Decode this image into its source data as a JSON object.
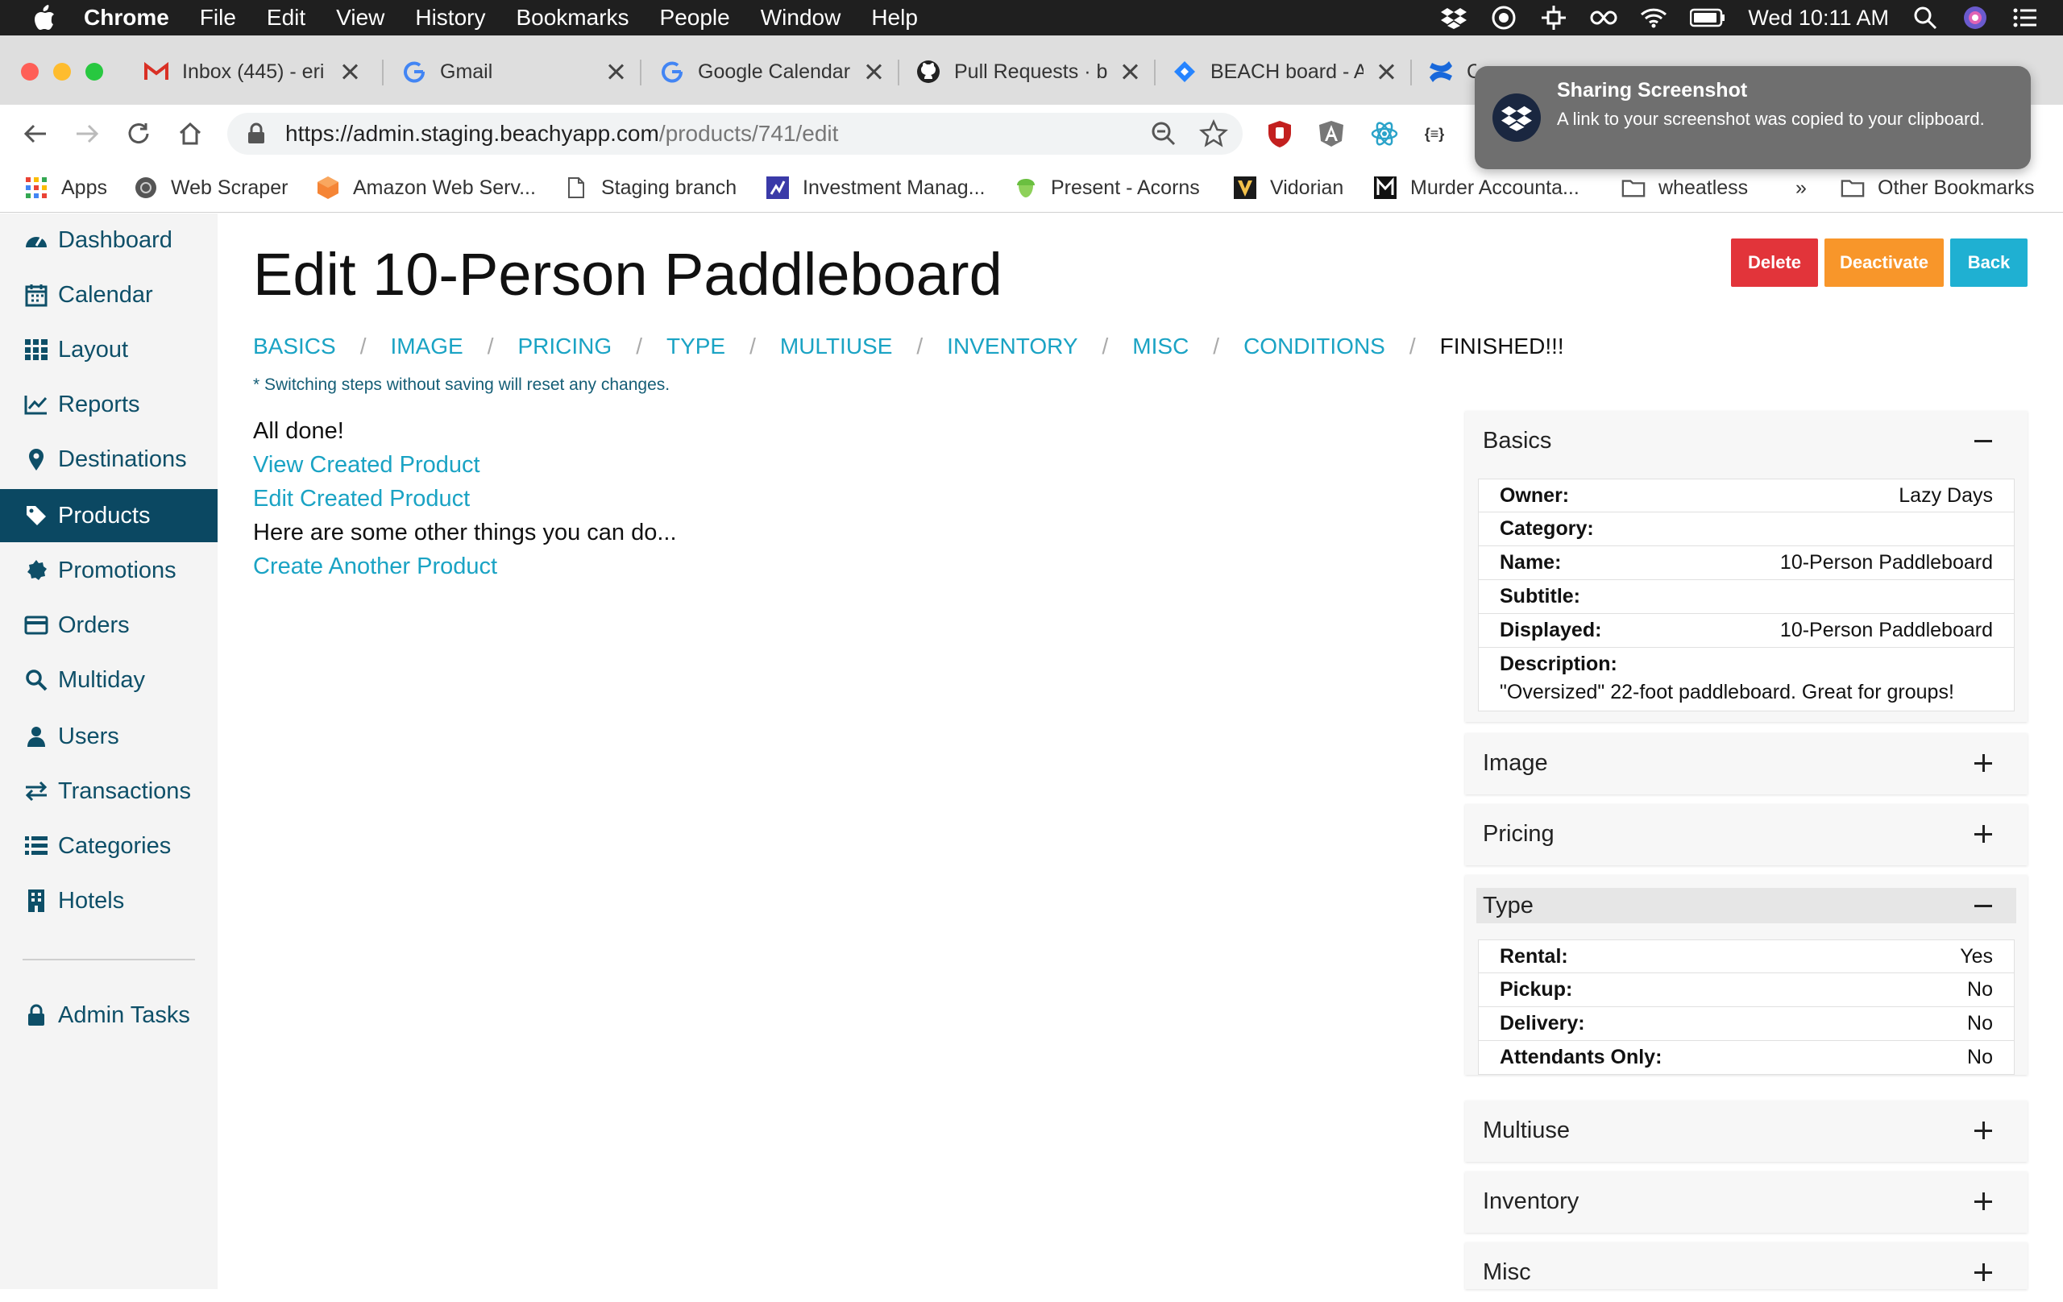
{
  "menubar": {
    "app": "Chrome",
    "items": [
      "File",
      "Edit",
      "View",
      "History",
      "Bookmarks",
      "People",
      "Window",
      "Help"
    ],
    "clock": "Wed 10:11 AM"
  },
  "tabs": [
    {
      "title": "Inbox (445) - eri",
      "icon": "gmail-icon"
    },
    {
      "title": "Gmail",
      "icon": "google-icon"
    },
    {
      "title": "Google Calendar",
      "icon": "google-icon"
    },
    {
      "title": "Pull Requests · b",
      "icon": "github-icon"
    },
    {
      "title": "BEACH board - A",
      "icon": "jira-icon"
    },
    {
      "title": "C",
      "icon": "confluence-icon"
    }
  ],
  "omnibox": {
    "url_host": "https://admin.staging.beachyapp.com",
    "url_path": "/products/741/edit"
  },
  "bookmarks": [
    {
      "label": "Apps",
      "icon": "apps-grid-icon"
    },
    {
      "label": "Web Scraper",
      "icon": "web-scraper-icon"
    },
    {
      "label": "Amazon Web Serv...",
      "icon": "aws-icon"
    },
    {
      "label": "Staging branch",
      "icon": "page-icon"
    },
    {
      "label": "Investment Manag...",
      "icon": "investment-icon"
    },
    {
      "label": "Present - Acorns",
      "icon": "acorns-icon"
    },
    {
      "label": "Vidorian",
      "icon": "vidorian-icon"
    },
    {
      "label": "Murder Accounta...",
      "icon": "murder-icon"
    },
    {
      "label": "wheatless",
      "icon": "folder-icon"
    },
    {
      "label": "»",
      "icon": ""
    },
    {
      "label": "Other Bookmarks",
      "icon": "folder-icon"
    }
  ],
  "notification": {
    "title": "Sharing Screenshot",
    "body": "A link to your screenshot was copied to your clipboard."
  },
  "sidebar": {
    "items": [
      {
        "label": "Dashboard",
        "icon": "dashboard-icon"
      },
      {
        "label": "Calendar",
        "icon": "calendar-icon"
      },
      {
        "label": "Layout",
        "icon": "layout-grid-icon"
      },
      {
        "label": "Reports",
        "icon": "reports-chart-icon"
      },
      {
        "label": "Destinations",
        "icon": "map-pin-icon"
      },
      {
        "label": "Products",
        "icon": "tag-icon",
        "active": true
      },
      {
        "label": "Promotions",
        "icon": "badge-icon"
      },
      {
        "label": "Orders",
        "icon": "credit-card-icon"
      },
      {
        "label": "Multiday",
        "icon": "search-icon"
      },
      {
        "label": "Users",
        "icon": "user-icon"
      },
      {
        "label": "Transactions",
        "icon": "exchange-icon"
      },
      {
        "label": "Categories",
        "icon": "list-icon"
      },
      {
        "label": "Hotels",
        "icon": "building-icon"
      }
    ],
    "admin": {
      "label": "Admin Tasks",
      "icon": "lock-icon"
    }
  },
  "page": {
    "title": "Edit 10-Person Paddleboard",
    "buttons": {
      "delete": "Delete",
      "deactivate": "Deactivate",
      "back": "Back"
    },
    "steps": [
      "BASICS",
      "IMAGE",
      "PRICING",
      "TYPE",
      "MULTIUSE",
      "INVENTORY",
      "MISC",
      "CONDITIONS",
      "FINISHED!!!"
    ],
    "step_separator": "/",
    "current_step": "FINISHED!!!",
    "warning": "* Switching steps without saving will reset any changes.",
    "done": {
      "heading": "All done!",
      "view_link": "View Created Product",
      "edit_link": "Edit Created Product",
      "other_text": "Here are some other things you can do...",
      "create_link": "Create Another Product"
    }
  },
  "panels": {
    "basics": {
      "title": "Basics",
      "rows": [
        {
          "k": "Owner:",
          "v": "Lazy Days"
        },
        {
          "k": "Category:",
          "v": ""
        },
        {
          "k": "Name:",
          "v": "10-Person Paddleboard"
        },
        {
          "k": "Subtitle:",
          "v": ""
        },
        {
          "k": "Displayed:",
          "v": "10-Person Paddleboard"
        }
      ],
      "description_label": "Description:",
      "description": "\"Oversized\" 22-foot paddleboard. Great for groups!"
    },
    "image": {
      "title": "Image"
    },
    "pricing": {
      "title": "Pricing"
    },
    "type": {
      "title": "Type",
      "rows": [
        {
          "k": "Rental:",
          "v": "Yes"
        },
        {
          "k": "Pickup:",
          "v": "No"
        },
        {
          "k": "Delivery:",
          "v": "No"
        },
        {
          "k": "Attendants Only:",
          "v": "No"
        }
      ]
    },
    "multiuse": {
      "title": "Multiuse"
    },
    "inventory": {
      "title": "Inventory"
    },
    "misc": {
      "title": "Misc"
    }
  },
  "colors": {
    "link": "#1aa3c4",
    "sidebar_active": "#0b4862",
    "delete": "#e2343a",
    "deactivate": "#f8962a",
    "back": "#1fb0d2"
  }
}
